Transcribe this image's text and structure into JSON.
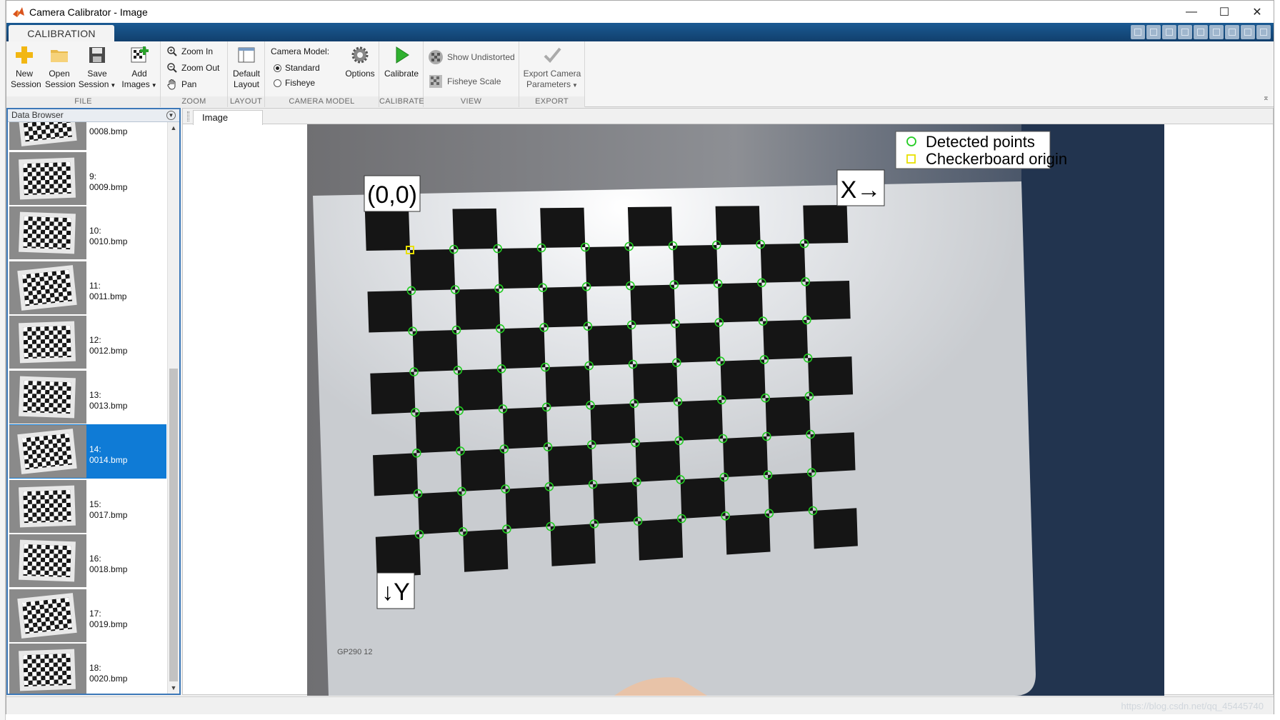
{
  "window": {
    "title": "Camera Calibrator - Image",
    "min_glyph": "—",
    "max_glyph": "☐",
    "close_glyph": "✕"
  },
  "ribbon": {
    "tab_label": "CALIBRATION",
    "sections": {
      "file": "FILE",
      "zoom": "ZOOM",
      "layout": "LAYOUT",
      "camera_model": "CAMERA MODEL",
      "calibrate": "CALIBRATE",
      "view": "VIEW",
      "export": "EXPORT"
    },
    "buttons": {
      "new_session_1": "New",
      "new_session_2": "Session",
      "open_session_1": "Open",
      "open_session_2": "Session",
      "save_session_1": "Save",
      "save_session_2": "Session",
      "add_images_1": "Add",
      "add_images_2": "Images",
      "zoom_in": "Zoom In",
      "zoom_out": "Zoom Out",
      "pan": "Pan",
      "default_layout_1": "Default",
      "default_layout_2": "Layout",
      "camera_model_label": "Camera Model:",
      "standard": "Standard",
      "fisheye": "Fisheye",
      "options": "Options",
      "calibrate": "Calibrate",
      "show_undistorted": "Show Undistorted",
      "fisheye_scale": "Fisheye Scale",
      "export_1": "Export Camera",
      "export_2": "Parameters"
    },
    "camera_model_selected": "Standard"
  },
  "data_browser": {
    "title": "Data Browser",
    "items": [
      {
        "num": "",
        "file": "0008.bmp"
      },
      {
        "num": "9:",
        "file": "0009.bmp"
      },
      {
        "num": "10:",
        "file": "0010.bmp"
      },
      {
        "num": "11:",
        "file": "0011.bmp"
      },
      {
        "num": "12:",
        "file": "0012.bmp"
      },
      {
        "num": "13:",
        "file": "0013.bmp"
      },
      {
        "num": "14:",
        "file": "0014.bmp"
      },
      {
        "num": "15:",
        "file": "0017.bmp"
      },
      {
        "num": "16:",
        "file": "0018.bmp"
      },
      {
        "num": "17:",
        "file": "0019.bmp"
      },
      {
        "num": "18:",
        "file": "0020.bmp"
      }
    ],
    "selected_index": 6
  },
  "document": {
    "tab_label": "Image",
    "legend": {
      "detected": "Detected points",
      "origin": "Checkerboard origin"
    },
    "origin_label": "(0,0)",
    "x_axis_label": "X→",
    "y_axis_label": "↓Y",
    "board_text": "GP290  12",
    "detected_color": "#22cc22",
    "origin_color": "#e8e000"
  },
  "status": {
    "watermark": "https://blog.csdn.net/qq_45445740"
  }
}
